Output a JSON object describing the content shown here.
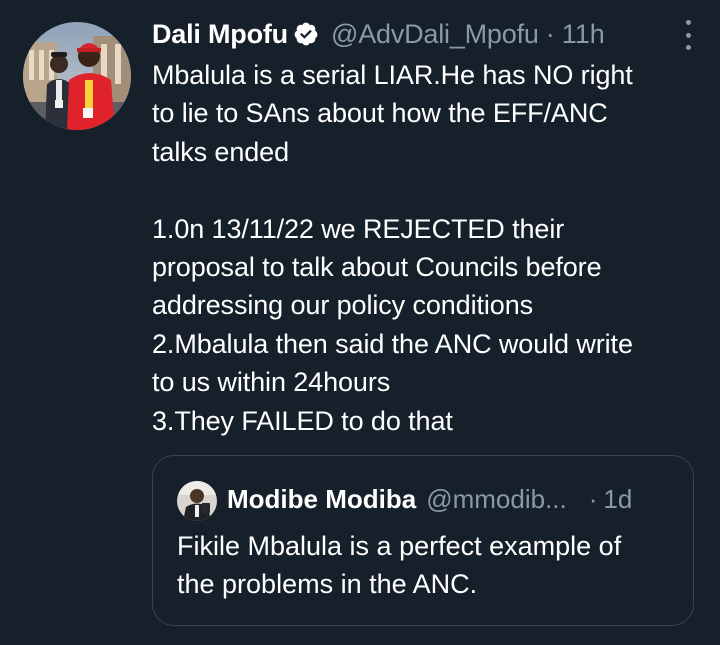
{
  "colors": {
    "background": "#15202b",
    "text_primary": "#ffffff",
    "text_secondary": "#8b98a5",
    "border": "#38444d",
    "verified_badge": "#ffffff"
  },
  "tweet": {
    "author": {
      "display_name": "Dali Mpofu",
      "handle": "@AdvDali_Mpofu",
      "verified": true
    },
    "separator": "·",
    "time": "11h",
    "more_icon": "more-vertical-icon",
    "text_lines": [
      "Mbalula is a serial LIAR.He has NO right",
      "to lie to SAns about how the EFF/ANC",
      "talks ended",
      "",
      "1.0n 13/11/22 we REJECTED their",
      "proposal to talk about Councils before",
      "addressing our policy conditions",
      "2.Mbalula then said the ANC would write",
      "to us within 24hours",
      "3.They FAILED to do that"
    ]
  },
  "quoted_tweet": {
    "author": {
      "display_name": "Modibe Modiba",
      "handle": "@mmodib..."
    },
    "separator": "·",
    "time": "1d",
    "text_lines": [
      "Fikile Mbalula is a perfect example of",
      "the problems in the ANC."
    ]
  }
}
